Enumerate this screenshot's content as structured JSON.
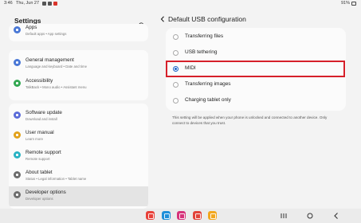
{
  "status_bar": {
    "time": "3:46",
    "date": "Thu, Jun 27",
    "battery": "91%",
    "notification_colors": [
      "#555555",
      "#555555",
      "#d9342b"
    ]
  },
  "left_pane": {
    "title": "Settings",
    "search_icon": "search-icon",
    "items": [
      {
        "title": "Apps",
        "subtitle": "Default apps  •  App settings",
        "icon": "apps-icon",
        "color": "#4a78d6"
      },
      {
        "title": "General management",
        "subtitle": "Language and keyboard  •  Date and time",
        "icon": "sliders-icon",
        "color": "#4a78d6"
      },
      {
        "title": "Accessibility",
        "subtitle": "TalkBack  •  Mono audio  •  Assistant menu",
        "icon": "accessibility-icon",
        "color": "#33a852"
      },
      {
        "title": "Software update",
        "subtitle": "Download and install",
        "icon": "update-icon",
        "color": "#5b6cd9"
      },
      {
        "title": "User manual",
        "subtitle": "Learn more",
        "icon": "manual-icon",
        "color": "#e2a21b"
      },
      {
        "title": "Remote support",
        "subtitle": "Remote support",
        "icon": "support-icon",
        "color": "#2ab3c4"
      },
      {
        "title": "About tablet",
        "subtitle": "Status  •  Legal information  •  Tablet name",
        "icon": "info-icon",
        "color": "#6d6d6d"
      },
      {
        "title": "Developer options",
        "subtitle": "Developer options",
        "icon": "developer-icon",
        "color": "#6d6d6d"
      }
    ]
  },
  "right_pane": {
    "title": "Default USB configuration",
    "options": [
      {
        "label": "Transferring files",
        "selected": false
      },
      {
        "label": "USB tethering",
        "selected": false
      },
      {
        "label": "MIDI",
        "selected": true
      },
      {
        "label": "Transferring images",
        "selected": false
      },
      {
        "label": "Charging tablet only",
        "selected": false
      }
    ],
    "info": "This setting will be applied when your phone is unlocked and connected to another device. Only connect to devices that you trust.",
    "highlight_color": "#d6202a"
  },
  "nav_bar": {
    "dock_apps": [
      {
        "name": "notes-app-icon",
        "color": "#e8413a"
      },
      {
        "name": "calendar-app-icon",
        "color": "#1f8fd9"
      },
      {
        "name": "gallery-app-icon",
        "color": "#d6327a"
      },
      {
        "name": "flow-app-icon",
        "color": "#e2433a"
      },
      {
        "name": "files-app-icon",
        "color": "#f2a71e"
      }
    ],
    "buttons": [
      "recents-icon",
      "home-icon",
      "back-icon"
    ]
  }
}
